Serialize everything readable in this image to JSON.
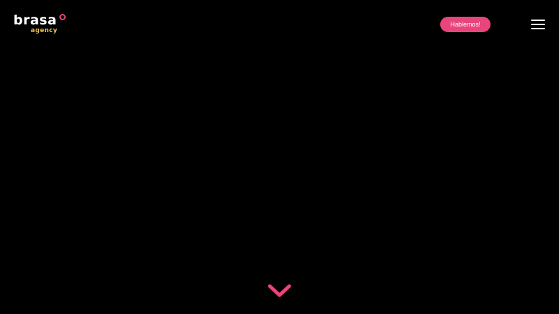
{
  "brand": {
    "name": "brasa",
    "sub": "agency",
    "accent_color": "#e8457c",
    "sub_color": "#f2c84b"
  },
  "header": {
    "cta_label": "Hablemos!",
    "menu_icon": "hamburger-menu-icon"
  },
  "hero": {
    "background": "#000000",
    "scroll_icon": "chevron-down-icon"
  }
}
